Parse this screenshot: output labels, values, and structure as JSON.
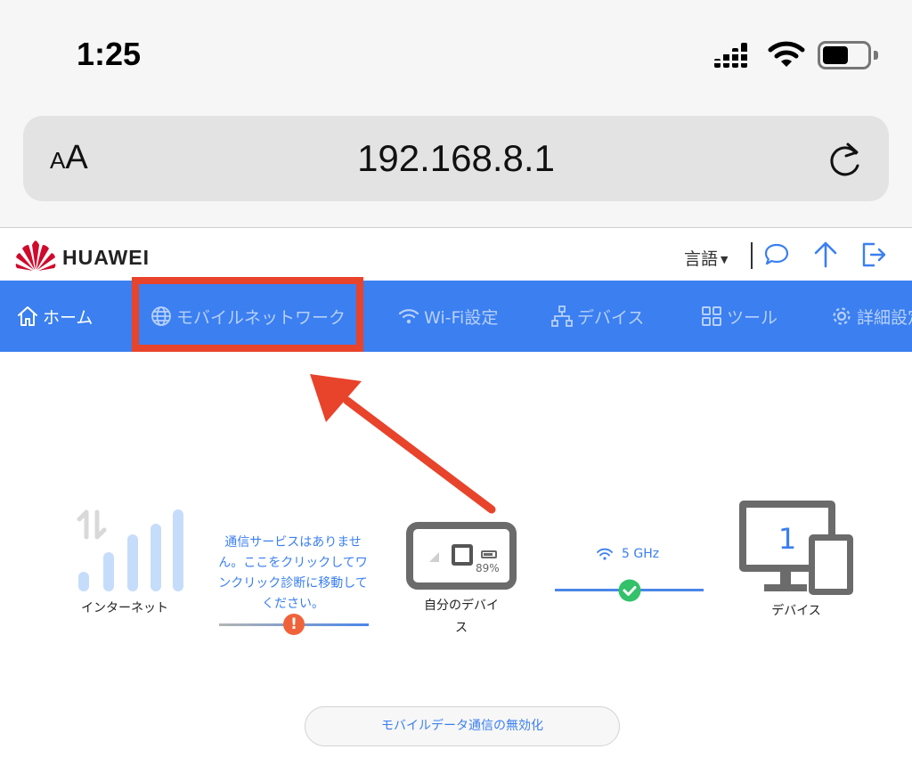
{
  "status_bar": {
    "time": "1:25",
    "icons": [
      "cellular-signal-icon",
      "wifi-icon",
      "battery-icon"
    ]
  },
  "browser": {
    "text_size_small": "A",
    "text_size_large": "A",
    "url": "192.168.8.1",
    "reload_icon": "reload-icon"
  },
  "router": {
    "brand": "HUAWEI",
    "header": {
      "language_label": "言語",
      "icons": [
        "chat-icon",
        "upload-icon",
        "logout-icon"
      ]
    },
    "nav": {
      "home": "ホーム",
      "mobile_network": "モバイルネットワーク",
      "wifi_settings": "Wi-Fi設定",
      "devices": "デバイス",
      "tools": "ツール",
      "advanced": "詳細設定"
    },
    "topology": {
      "internet_label": "インターネット",
      "notice": "通信サービスはありません。ここをクリックしてワンクリック診断に移動してください。",
      "my_device_label": "自分のデバイス",
      "battery_percent": "89%",
      "band": "5 GHz",
      "devices_label": "デバイス",
      "connected_devices": "1"
    },
    "disable_mobile_data_button": "モバイルデータ通信の無効化"
  },
  "colors": {
    "nav_blue": "#3b7ff0",
    "highlight_red": "#e8432b",
    "success_green": "#33c16a",
    "warning_orange": "#f0633a"
  }
}
